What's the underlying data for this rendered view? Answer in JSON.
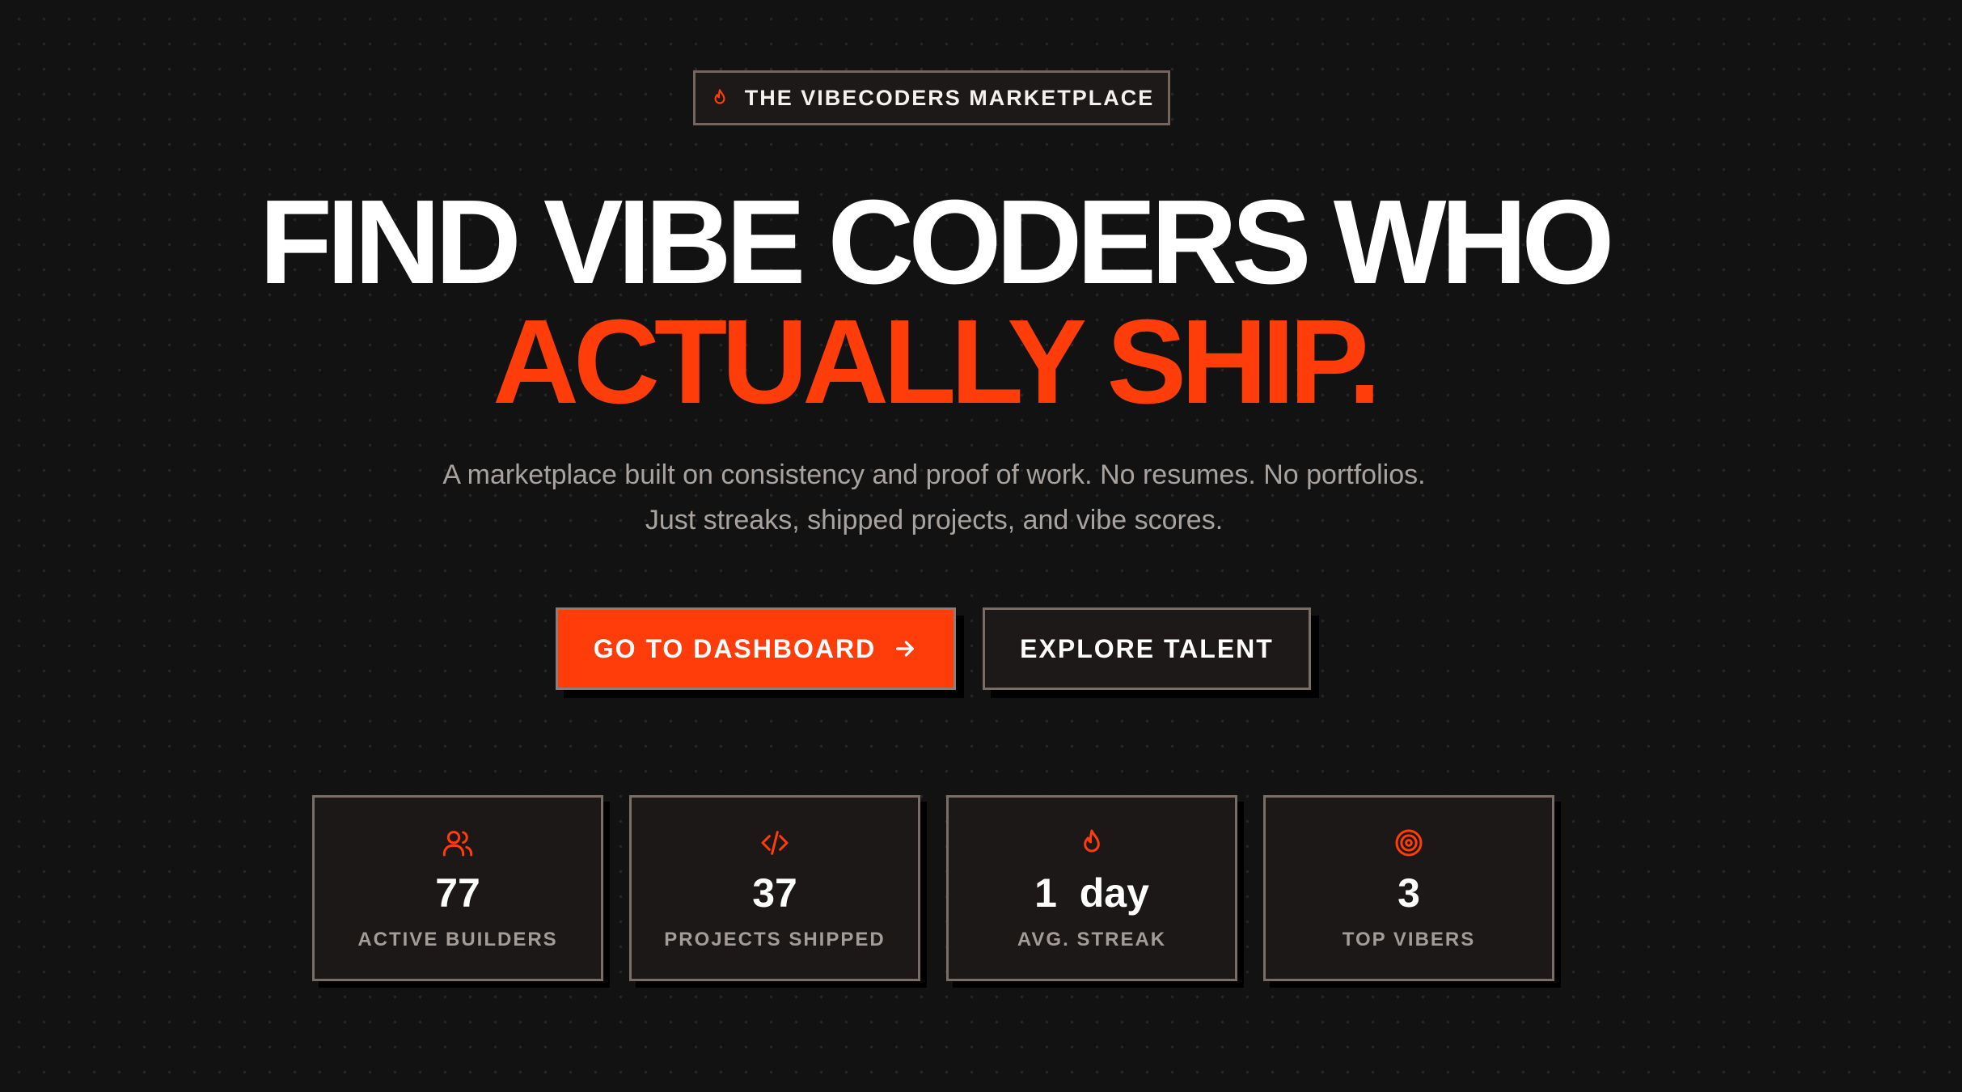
{
  "theme": {
    "accent": "#ff3d0a",
    "background": "#121212",
    "card_background": "#1b1817",
    "border": "#7a6d66",
    "muted_text": "#a9a3a0"
  },
  "badge": {
    "icon": "flame-icon",
    "label": "THE VIBECODERS MARKETPLACE"
  },
  "hero": {
    "headline_line1": "FIND VIBE CODERS WHO",
    "headline_line2": "ACTUALLY SHIP.",
    "subtitle_line1": "A marketplace built on consistency and proof of work. No resumes. No portfolios.",
    "subtitle_line2": "Just streaks, shipped projects, and vibe scores."
  },
  "actions": {
    "primary_label": "GO TO DASHBOARD",
    "primary_icon": "arrow-right-icon",
    "secondary_label": "EXPLORE TALENT"
  },
  "stats": [
    {
      "icon": "users-icon",
      "value": "77",
      "label": "ACTIVE BUILDERS"
    },
    {
      "icon": "code-icon",
      "value": "37",
      "label": "PROJECTS SHIPPED"
    },
    {
      "icon": "flame-icon",
      "value": "1  day",
      "label": "AVG. STREAK"
    },
    {
      "icon": "target-icon",
      "value": "3",
      "label": "TOP VIBERS"
    }
  ]
}
